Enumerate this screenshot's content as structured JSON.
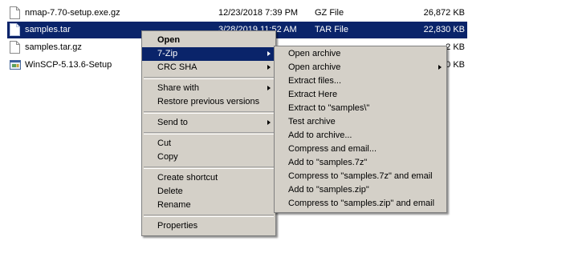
{
  "files": [
    {
      "name": "nmap-7.70-setup.exe.gz",
      "date": "12/23/2018 7:39 PM",
      "type": "GZ File",
      "size": "26,872 KB",
      "icon": "document-icon"
    },
    {
      "name": "samples.tar",
      "date": "3/28/2019 11:52 AM",
      "type": "TAR File",
      "size": "22,830 KB",
      "icon": "document-icon"
    },
    {
      "name": "samples.tar.gz",
      "date": "",
      "type": "",
      "size": "2 KB",
      "icon": "document-icon"
    },
    {
      "name": "WinSCP-5.13.6-Setup",
      "date": "",
      "type": "",
      "size": "0 KB",
      "icon": "installer-icon"
    }
  ],
  "context_menu": {
    "open": "Open",
    "zip7": "7-Zip",
    "crc_sha": "CRC SHA",
    "share_with": "Share with",
    "restore": "Restore previous versions",
    "send_to": "Send to",
    "cut": "Cut",
    "copy": "Copy",
    "create_shortcut": "Create shortcut",
    "delete": "Delete",
    "rename": "Rename",
    "properties": "Properties"
  },
  "zip_submenu": {
    "items": [
      "Open archive",
      "Open archive",
      "Extract files...",
      "Extract Here",
      "Extract to \"samples\\\"",
      "Test archive",
      "Add to archive...",
      "Compress and email...",
      "Add to \"samples.7z\"",
      "Compress to \"samples.7z\" and email",
      "Add to \"samples.zip\"",
      "Compress to \"samples.zip\" and email"
    ]
  },
  "colors": {
    "selection": "#0a246a",
    "menu_bg": "#d4d0c8"
  }
}
